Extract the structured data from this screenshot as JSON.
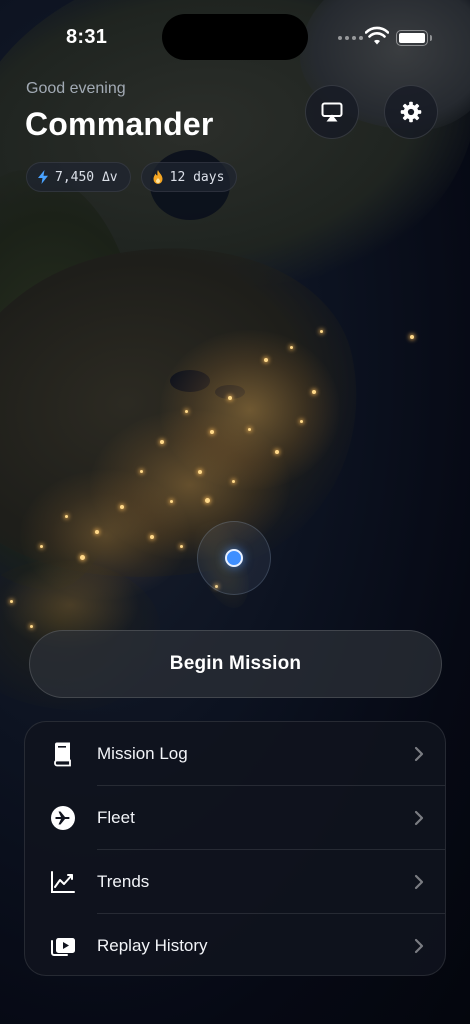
{
  "status_bar": {
    "time": "8:31"
  },
  "header": {
    "greeting": "Good evening",
    "name": "Commander",
    "stats": [
      {
        "icon": "lightning-icon",
        "value": "7,450 Δv"
      },
      {
        "icon": "flame-icon",
        "value": "12 days"
      }
    ]
  },
  "actions": {
    "primary_label": "Begin Mission"
  },
  "menu": {
    "items": [
      {
        "icon": "book-icon",
        "label": "Mission Log"
      },
      {
        "icon": "airplane-icon",
        "label": "Fleet"
      },
      {
        "icon": "chart-line-icon",
        "label": "Trends"
      },
      {
        "icon": "replay-icon",
        "label": "Replay History"
      }
    ]
  },
  "colors": {
    "accent_blue": "#3f8fff",
    "lightning": "#4aa3ff",
    "flame": "#f5a623",
    "city_lights": "#ffd98a"
  }
}
